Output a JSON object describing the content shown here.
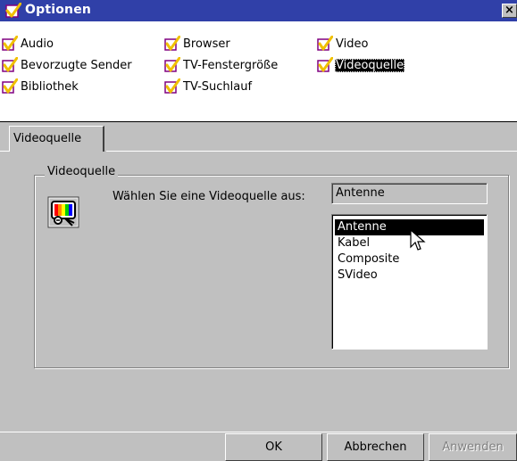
{
  "window": {
    "title": "Optionen",
    "close_symbol": "×"
  },
  "categories": [
    {
      "label": "Audio",
      "checked": true
    },
    {
      "label": "Bevorzugte Sender",
      "checked": true
    },
    {
      "label": "Bibliothek",
      "checked": true
    },
    {
      "label": "Browser",
      "checked": true
    },
    {
      "label": "TV-Fenstergröße",
      "checked": true
    },
    {
      "label": "TV-Suchlauf",
      "checked": true
    },
    {
      "label": "Video",
      "checked": true
    },
    {
      "label": "Videoquelle",
      "checked": true,
      "selected": true
    }
  ],
  "tabs": [
    {
      "label": "Videoquelle",
      "active": true
    }
  ],
  "videoquelle": {
    "group_label": "Videoquelle",
    "prompt": "Wählen Sie eine Videoquelle aus:",
    "current_value": "Antenne",
    "options": [
      "Antenne",
      "Kabel",
      "Composite",
      "SVideo"
    ],
    "selected_option": "Antenne"
  },
  "buttons": {
    "ok": "OK",
    "cancel": "Abbrechen",
    "apply": "Anwenden",
    "apply_enabled": false
  },
  "icons": {
    "title": "check-icon",
    "category": "checkbox-check-icon",
    "source": "tv-icon"
  },
  "colors": {
    "titlebar": "#3040a8",
    "face": "#c0c0c0",
    "check_mark": "#f0c000",
    "checkbox_border": "#800080"
  }
}
